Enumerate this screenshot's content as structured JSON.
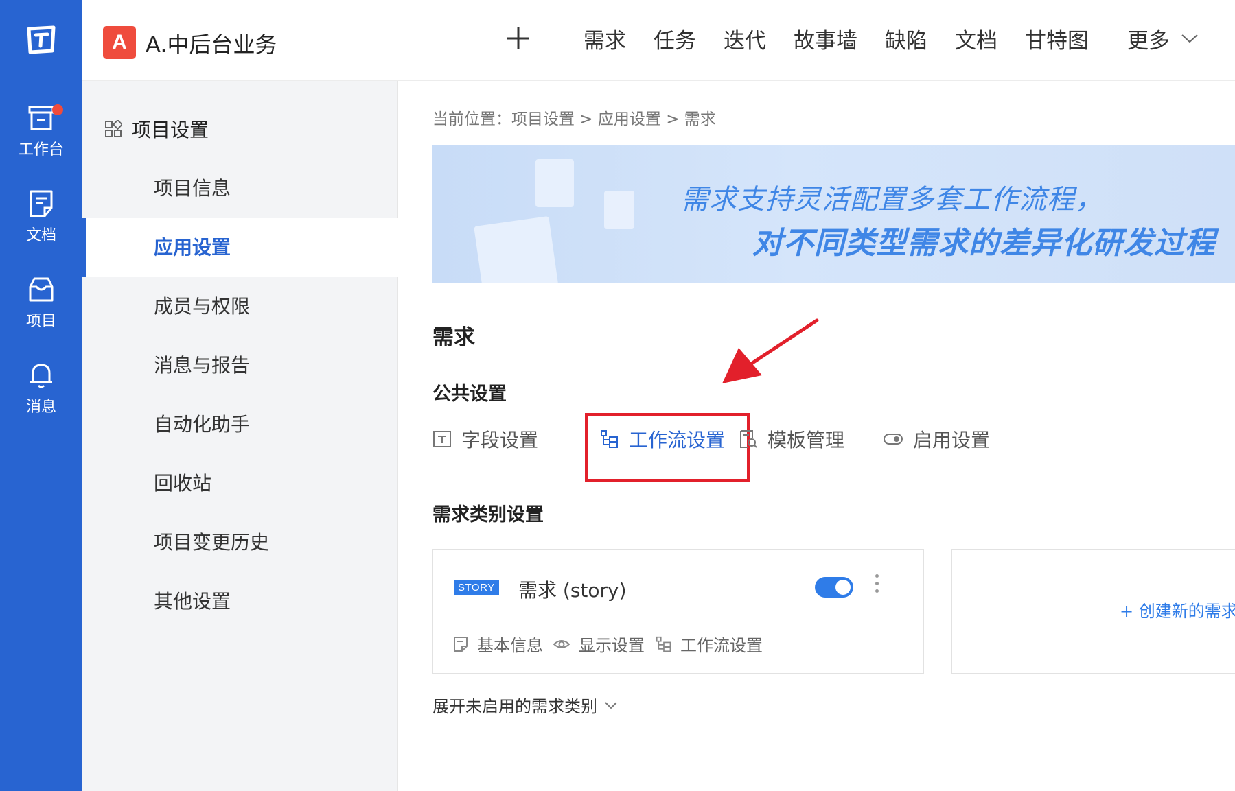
{
  "rail": {
    "items": [
      {
        "label": "工作台",
        "icon": "workbench-icon",
        "has_badge": true
      },
      {
        "label": "文档",
        "icon": "document-icon"
      },
      {
        "label": "项目",
        "icon": "project-inbox-icon"
      },
      {
        "label": "消息",
        "icon": "bell-icon"
      }
    ]
  },
  "header": {
    "project_badge": "A",
    "project_name": "A.中后台业务",
    "nav": [
      "需求",
      "任务",
      "迭代",
      "故事墙",
      "缺陷",
      "文档",
      "甘特图"
    ],
    "more_label": "更多"
  },
  "sidebar": {
    "title": "项目设置",
    "items": [
      {
        "label": "项目信息"
      },
      {
        "label": "应用设置",
        "active": true
      },
      {
        "label": "成员与权限"
      },
      {
        "label": "消息与报告"
      },
      {
        "label": "自动化助手"
      },
      {
        "label": "回收站"
      },
      {
        "label": "项目变更历史"
      },
      {
        "label": "其他设置"
      }
    ]
  },
  "main": {
    "breadcrumb": "当前位置：项目设置 > 应用设置 > 需求",
    "banner": {
      "line1": "需求支持灵活配置多套工作流程，",
      "line2": "对不同类型需求的差异化研发过程"
    },
    "section_title": "需求",
    "public_title": "公共设置",
    "public_items": [
      {
        "label": "字段设置",
        "icon": "field-settings-icon"
      },
      {
        "label": "工作流设置",
        "icon": "workflow-icon",
        "highlighted": true
      },
      {
        "label": "模板管理",
        "icon": "template-icon"
      },
      {
        "label": "启用设置",
        "icon": "toggle-icon"
      }
    ],
    "category_title": "需求类别设置",
    "card": {
      "tag": "STORY",
      "title": "需求 (story)",
      "enabled": true,
      "links": [
        "基本信息",
        "显示设置",
        "工作流设置"
      ]
    },
    "create_label": "+ 创建新的需求",
    "expand_label": "展开未启用的需求类别"
  },
  "colors": {
    "brand": "#2864d1",
    "accent": "#2f7ce8",
    "highlight": "#e2202b",
    "project_badge": "#ef4c3d"
  }
}
